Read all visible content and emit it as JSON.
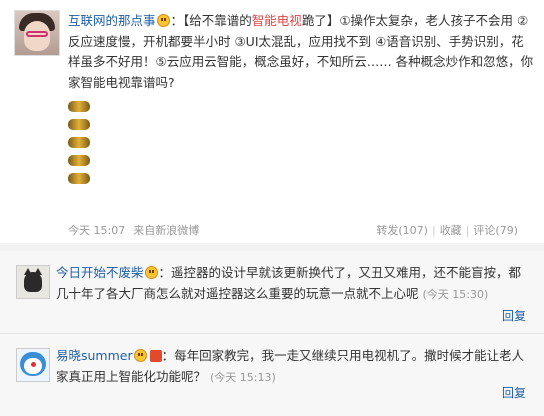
{
  "post": {
    "author": "互联网的那点事",
    "colon": "：",
    "body_part1": "【给不靠谱的",
    "body_highlight": "智能电视",
    "body_part2": "跪了】①操作太复杂，老人孩子不会用 ②反应速度慢，开机都要半小时 ③UI太混乱，应用找不到 ④语音识别、手势识别，花样虽多不好用！⑤云应用云智能，概念虽好，不知所云…… 各种概念炒作和忽悠，你家智能电视靠谱吗?",
    "time": "今天 15:07",
    "source": "来自新浪微博",
    "repost": "转发(107)",
    "favorite": "收藏",
    "comment": "评论(79)"
  },
  "comments": [
    {
      "author": "今日开始不废柴",
      "text": "：遥控器的设计早就该更新换代了，又丑又难用，还不能盲按，都几十年了各大厂商怎么就对遥控器这么重要的玩意一点就不上心呢",
      "time": "(今天  15:30)",
      "reply": "回复"
    },
    {
      "author": "易晓summer",
      "text": "：每年回家教完，我一走又继续只用电视机了。撒时候才能让老人家真正用上智能化功能呢？",
      "time": "(今天  15:13)",
      "reply": "回复"
    }
  ],
  "colors": {
    "link": "#1f5ea8",
    "highlight": "#dd4444",
    "meta": "#999999",
    "comment_bg": "#f7f7f7"
  },
  "icons": [
    "smiley-emoji-icon",
    "gif-animation-icon",
    "vip-badge-icon"
  ]
}
